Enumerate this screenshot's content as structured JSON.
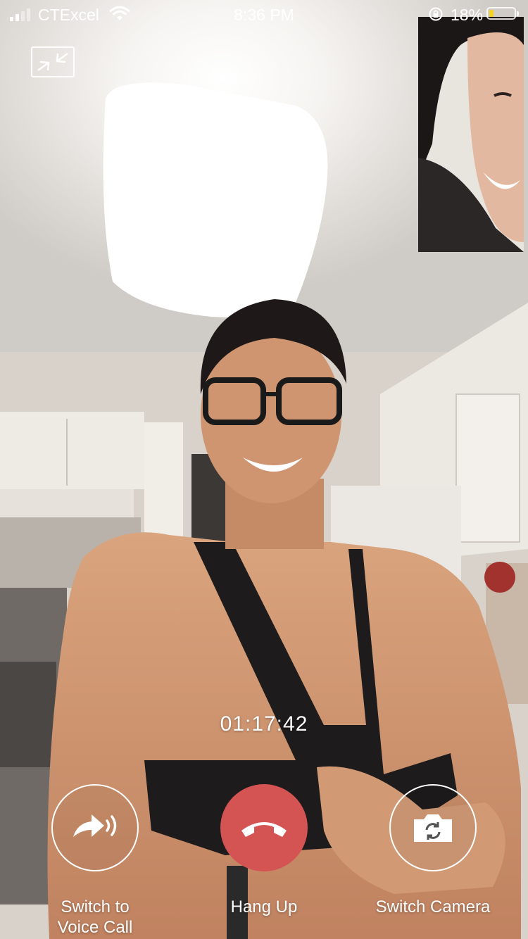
{
  "status_bar": {
    "carrier": "CTExcel",
    "time": "8:36 PM",
    "battery_percent": "18%",
    "battery_level": 0.18,
    "battery_color": "#f5d21c"
  },
  "call": {
    "timer": "01:17:42"
  },
  "actions": {
    "switch_to_voice": {
      "label": "Switch to\nVoice Call",
      "icon": "arrow-sound-icon"
    },
    "hang_up": {
      "label": "Hang Up",
      "icon": "phone-hangup-icon",
      "color": "#d45454"
    },
    "switch_camera": {
      "label": "Switch Camera",
      "icon": "camera-rotate-icon"
    }
  },
  "colors": {
    "hangup": "#d45454",
    "overlay_text": "#ffffff"
  }
}
